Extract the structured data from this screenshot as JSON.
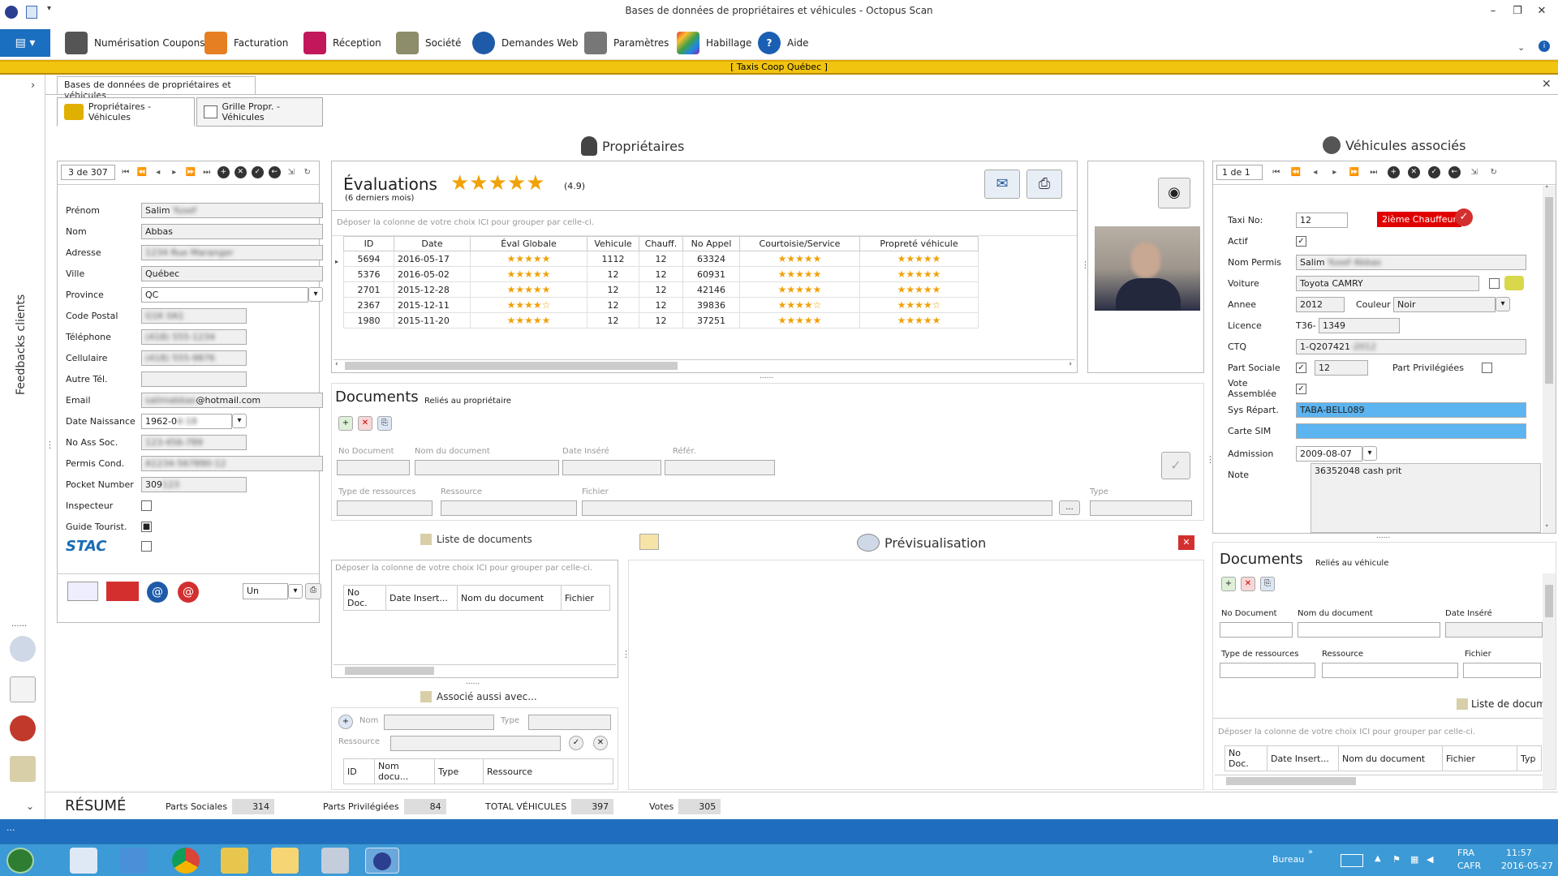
{
  "window": {
    "title": "Bases de données de propriétaires et véhicules - Octopus Scan"
  },
  "ribbon": {
    "items": [
      {
        "label": "Numérisation Coupons",
        "icon": "scanner-icon",
        "color": "#555"
      },
      {
        "label": "Facturation",
        "icon": "invoice-icon",
        "color": "#e67e22"
      },
      {
        "label": "Réception",
        "icon": "reception-icon",
        "color": "#c2185b"
      },
      {
        "label": "Société",
        "icon": "building-icon",
        "color": "#8d8d6b"
      },
      {
        "label": "Demandes Web",
        "icon": "globe-icon",
        "color": "#1e5aa8"
      },
      {
        "label": "Paramètres",
        "icon": "tools-icon",
        "color": "#777"
      },
      {
        "label": "Habillage",
        "icon": "palette-icon",
        "color": "#7b3fa0"
      },
      {
        "label": "Aide",
        "icon": "help-icon",
        "color": "#1a5fb4"
      }
    ]
  },
  "banner": {
    "text": "[  Taxis Coop Québec  ]"
  },
  "leftbar": {
    "vertical_label": "Feedbacks clients"
  },
  "doc_tab": {
    "label": "Bases de données de propriétaires et véhicules"
  },
  "subtabs": [
    {
      "label": "Propriétaires - Véhicules"
    },
    {
      "label": "Grille Propr. - Véhicules"
    }
  ],
  "owners": {
    "header": "Propriétaires",
    "nav_position": "3 de 307",
    "fields": {
      "prenom": {
        "label": "Prénom",
        "value": "Salim",
        "blurred": "Yusef"
      },
      "nom": {
        "label": "Nom",
        "value": "Abbas"
      },
      "adresse": {
        "label": "Adresse",
        "blurred": "1234 Rue Maranger"
      },
      "ville": {
        "label": "Ville",
        "value": "Québec"
      },
      "province": {
        "label": "Province",
        "value": "QC"
      },
      "code_postal": {
        "label": "Code Postal",
        "blurred": "G1K 0A1"
      },
      "telephone": {
        "label": "Téléphone",
        "blurred": "(418) 555-1234"
      },
      "cellulaire": {
        "label": "Cellulaire",
        "blurred": "(418) 555-9876"
      },
      "autre_tel": {
        "label": "Autre Tél."
      },
      "email": {
        "label": "Email",
        "value": "@hotmail.com",
        "blurred": "salimabbas"
      },
      "date_naissance": {
        "label": "Date Naissance",
        "value": "1962-0",
        "blurred": "4-18"
      },
      "no_ass_soc": {
        "label": "No Ass Soc.",
        "blurred": "123-456-789"
      },
      "permis_cond": {
        "label": "Permis Cond.",
        "blurred": "A1234-567890-12"
      },
      "pocket_number": {
        "label": "Pocket Number",
        "value": "309",
        "blurred": "123"
      },
      "inspecteur": {
        "label": "Inspecteur"
      },
      "guide_tourist": {
        "label": "Guide Tourist."
      }
    },
    "stac_logo": "STAC",
    "lang_select": "Un"
  },
  "evaluations": {
    "title": "Évaluations",
    "subtitle": "(6 derniers mois)",
    "score": "(4.9)",
    "group_hint": "Déposer la colonne de votre choix ICI pour grouper par celle-ci.",
    "columns": [
      "ID",
      "Date",
      "Éval Globale",
      "Vehicule",
      "Chauff.",
      "No Appel",
      "Courtoisie/Service",
      "Propreté véhicule"
    ],
    "rows": [
      {
        "id": "5694",
        "date": "2016-05-17",
        "vehicule": "1112",
        "chauff": "12",
        "appel": "63324",
        "g": "★★★★★",
        "c": "★★★★★",
        "p": "★★★★★"
      },
      {
        "id": "5376",
        "date": "2016-05-02",
        "vehicule": "12",
        "chauff": "12",
        "appel": "60931",
        "g": "★★★★★",
        "c": "★★★★★",
        "p": "★★★★★"
      },
      {
        "id": "2701",
        "date": "2015-12-28",
        "vehicule": "12",
        "chauff": "12",
        "appel": "42146",
        "g": "★★★★★",
        "c": "★★★★★",
        "p": "★★★★★"
      },
      {
        "id": "2367",
        "date": "2015-12-11",
        "vehicule": "12",
        "chauff": "12",
        "appel": "39836",
        "g": "★★★★☆",
        "c": "★★★★☆",
        "p": "★★★★☆"
      },
      {
        "id": "1980",
        "date": "2015-11-20",
        "vehicule": "12",
        "chauff": "12",
        "appel": "37251",
        "g": "★★★★★",
        "c": "★★★★★",
        "p": "★★★★★"
      }
    ]
  },
  "owner_documents": {
    "title": "Documents",
    "subtitle": "Reliés au propriétaire",
    "fields": {
      "no_document": "No Document",
      "nom_document": "Nom du document",
      "date_insere": "Date Inséré",
      "refer": "Référ.",
      "type_ressources": "Type de ressources",
      "ressource": "Ressource",
      "fichier": "Fichier",
      "type": "Type"
    },
    "browse": "...",
    "list_title": "Liste de documents",
    "list_group_hint": "Déposer la colonne de votre choix ICI pour grouper par celle-ci.",
    "list_columns": [
      "No Doc.",
      "Date Insert...",
      "Nom du document",
      "Fichier"
    ],
    "assoc_title": "Associé aussi avec...",
    "assoc_fields": {
      "nom": "Nom",
      "type": "Type",
      "ressource": "Ressource"
    },
    "assoc_columns": [
      "ID",
      "Nom docu...",
      "Type",
      "Ressource"
    ]
  },
  "preview": {
    "title": "Prévisualisation"
  },
  "vehicles": {
    "header": "Véhicules associés",
    "nav_position": "1 de 1",
    "second_driver": "2ième Chauffeur",
    "fields": {
      "taxi_no": {
        "label": "Taxi No:",
        "value": "12"
      },
      "actif": {
        "label": "Actif"
      },
      "nom_permis": {
        "label": "Nom Permis",
        "value": "Salim",
        "blurred": "Yusef Abbas"
      },
      "voiture": {
        "label": "Voiture",
        "value": "Toyota CAMRY"
      },
      "annee": {
        "label": "Annee",
        "value": "2012"
      },
      "couleur": {
        "label": "Couleur",
        "value": "Noir"
      },
      "licence": {
        "label": "Licence",
        "prefix": "T36-",
        "value": "1349"
      },
      "ctq": {
        "label": "CTQ",
        "value": "1-Q207421",
        "blurred": "-2012"
      },
      "part_sociale": {
        "label": "Part Sociale",
        "value": "12"
      },
      "part_priv": {
        "label": "Part Privilégiées"
      },
      "vote": {
        "label": "Vote Assemblée"
      },
      "sys_repart": {
        "label": "Sys Répart.",
        "value": "TABA-BELL089"
      },
      "carte_sim": {
        "label": "Carte SIM"
      },
      "admission": {
        "label": "Admission",
        "value": "2009-08-07"
      },
      "note": {
        "label": "Note",
        "value": "36352048 cash prit"
      }
    }
  },
  "vehicle_documents": {
    "title": "Documents",
    "subtitle": "Reliés au véhicule",
    "fields": {
      "no_document": "No Document",
      "nom_document": "Nom du document",
      "date_insere": "Date Inséré",
      "type_ressources": "Type de ressources",
      "ressource": "Ressource",
      "fichier": "Fichier"
    },
    "list_title": "Liste de docum",
    "list_group_hint": "Déposer la colonne de votre choix ICI pour grouper par celle-ci.",
    "list_columns": [
      "No Doc.",
      "Date Insert...",
      "Nom du document",
      "Fichier",
      "Typ"
    ]
  },
  "resume": {
    "title": "RÉSUMÉ",
    "parts_sociales": {
      "label": "Parts Sociales",
      "value": "314"
    },
    "parts_priv": {
      "label": "Parts Privilégiées",
      "value": "84"
    },
    "total": {
      "label": "TOTAL VÉHICULES",
      "value": "397"
    },
    "votes": {
      "label": "Votes",
      "value": "305"
    }
  },
  "statusbar": {
    "text": "..."
  },
  "taskbar": {
    "bureau": "Bureau",
    "lang1": "FRA",
    "lang2": "CAFR",
    "time": "11:57",
    "date": "2016-05-27"
  }
}
